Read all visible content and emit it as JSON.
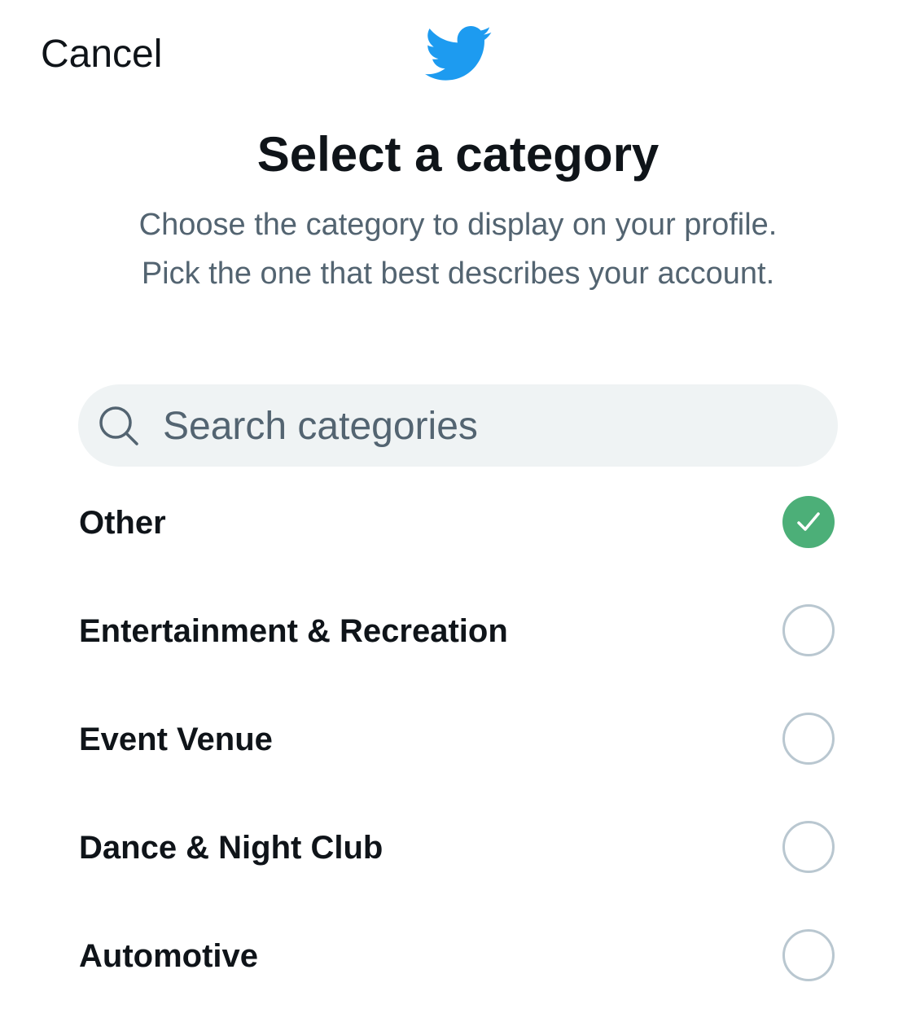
{
  "header": {
    "cancel_label": "Cancel",
    "logo_icon": "twitter-bird-icon",
    "brand_color": "#1d9bf0"
  },
  "title": "Select a category",
  "subtitle": "Choose the category to display on your profile. Pick the one that best describes your account.",
  "search": {
    "placeholder": "Search categories",
    "value": "",
    "icon": "search-icon"
  },
  "categories": [
    {
      "label": "Other",
      "selected": true
    },
    {
      "label": "Entertainment & Recreation",
      "selected": false
    },
    {
      "label": "Event Venue",
      "selected": false
    },
    {
      "label": "Dance & Night Club",
      "selected": false
    },
    {
      "label": "Automotive",
      "selected": false
    }
  ],
  "colors": {
    "text_primary": "#0f1419",
    "text_secondary": "#536471",
    "selected_check": "#4caf78",
    "radio_border": "#b9c7d0",
    "search_bg": "#eff3f4"
  }
}
